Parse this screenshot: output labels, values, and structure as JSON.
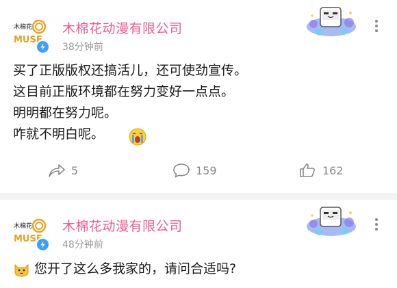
{
  "posts": [
    {
      "author": "木棉花动漫有限公司",
      "time": "38分钟前",
      "lines": [
        "买了正版版权还搞活儿，还可使劲宣传。",
        "这目前正版环境都在努力变好一点点。",
        "明明都在努力呢。",
        "咋就不明白呢。"
      ],
      "actions": {
        "share_count": "5",
        "comment_count": "159",
        "like_count": "162"
      }
    },
    {
      "author": "木棉花动漫有限公司",
      "time": "48分钟前",
      "lines": [
        "您开了这么多我家的，请问合适吗?"
      ]
    }
  ],
  "avatar": {
    "logo_text_top": "木棉花",
    "logo_text_bottom": "MUSE"
  },
  "colors": {
    "author_name": "#f05a8a",
    "meta": "#999999",
    "badge": "#3aa0ff",
    "separator": "#f2f2f2"
  },
  "icons": {
    "more": "more-vertical-icon",
    "share": "share-arrow-icon",
    "comment": "comment-bubble-icon",
    "like": "thumbs-up-icon",
    "verified": "verified-badge-icon",
    "cry": "crying-emoji-icon",
    "cat": "cat-emoji-icon",
    "mascot": "tv-mascot-decoration"
  }
}
